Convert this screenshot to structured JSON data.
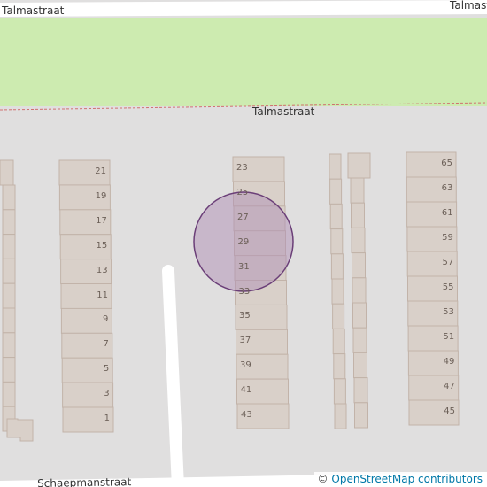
{
  "colors": {
    "background": "#e0dfdf",
    "road": "#ffffff",
    "park": "#cdebb0",
    "building_fill": "#d9d0c9",
    "building_stroke": "#c2b3a9",
    "marker_fill": "#b090b6",
    "marker_stroke": "#6b3f78",
    "boundary": "#d07070"
  },
  "streets": {
    "top_left": "Talmastraat",
    "top_right": "Talmastraat",
    "middle": "Talmastraat",
    "bottom": "Schaepmanstraat"
  },
  "house_numbers": {
    "left_block": [
      "21",
      "19",
      "17",
      "15",
      "13",
      "11",
      "9",
      "7",
      "5",
      "3",
      "1"
    ],
    "middle_block": [
      "23",
      "25",
      "27",
      "29",
      "31",
      "33",
      "35",
      "37",
      "39",
      "41",
      "43"
    ],
    "right_block": [
      "65",
      "63",
      "61",
      "59",
      "57",
      "55",
      "53",
      "51",
      "49",
      "47",
      "45"
    ]
  },
  "marker": {
    "icon": "location-circle"
  },
  "attribution": {
    "prefix": "©",
    "link": "OpenStreetMap contributors"
  }
}
